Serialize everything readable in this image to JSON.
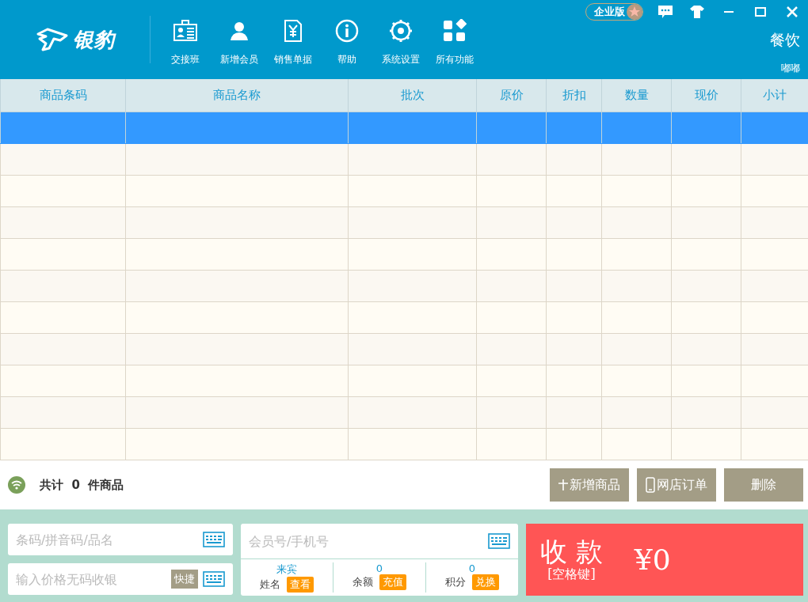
{
  "header": {
    "logo": "银豹",
    "toolbar": [
      {
        "label": "交接班"
      },
      {
        "label": "新增会员"
      },
      {
        "label": "销售单据"
      },
      {
        "label": "帮助"
      },
      {
        "label": "系统设置"
      },
      {
        "label": "所有功能"
      }
    ],
    "edition": "企业版",
    "industry": "餐饮",
    "user": "嘟嘟"
  },
  "table": {
    "columns": [
      "商品条码",
      "商品名称",
      "批次",
      "原价",
      "折扣",
      "数量",
      "现价",
      "小计"
    ],
    "rows": [
      {
        "selected": true
      },
      {
        "selected": false
      },
      {
        "selected": false
      },
      {
        "selected": false
      },
      {
        "selected": false
      },
      {
        "selected": false
      },
      {
        "selected": false
      },
      {
        "selected": false
      },
      {
        "selected": false
      },
      {
        "selected": false
      },
      {
        "selected": false
      }
    ]
  },
  "summary": {
    "prefix": "共计",
    "count": "0",
    "suffix": "件商品"
  },
  "actions": [
    {
      "label": "新增商品"
    },
    {
      "label": "网店订单"
    },
    {
      "label": "删除"
    }
  ],
  "product_search": {
    "placeholder": "条码/拼音码/品名"
  },
  "price_entry": {
    "placeholder": "输入价格无码收银",
    "shortcut": "快捷"
  },
  "member": {
    "placeholder": "会员号/手机号",
    "stats": [
      {
        "value": "来宾",
        "label": "姓名",
        "action": "查看"
      },
      {
        "value": "0",
        "label": "余额",
        "action": "充值"
      },
      {
        "value": "0",
        "label": "积分",
        "action": "兑换"
      }
    ]
  },
  "checkout": {
    "title": "收 款",
    "hint": "[空格键]",
    "amount": "¥0"
  }
}
